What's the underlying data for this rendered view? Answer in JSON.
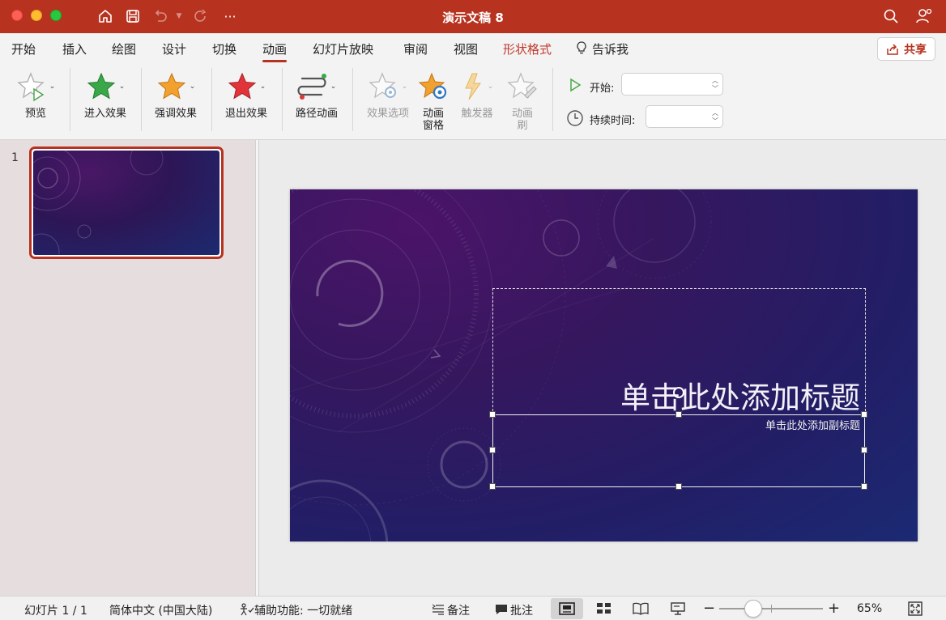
{
  "window": {
    "title": "演示文稿 8"
  },
  "tabs": [
    {
      "label": "开始"
    },
    {
      "label": "插入"
    },
    {
      "label": "绘图"
    },
    {
      "label": "设计"
    },
    {
      "label": "切换"
    },
    {
      "label": "动画",
      "active": true
    },
    {
      "label": "幻灯片放映"
    },
    {
      "label": "审阅"
    },
    {
      "label": "视图"
    },
    {
      "label": "形状格式",
      "accent": true
    },
    {
      "label": "告诉我",
      "icon": "lightbulb-icon"
    }
  ],
  "share": {
    "label": "共享"
  },
  "ribbon": {
    "preview": "预览",
    "entrance": "进入效果",
    "emphasis": "强调效果",
    "exit": "退出效果",
    "motion_path": "路径动画",
    "effect_options": "效果选项",
    "animation_pane_1": "动画",
    "animation_pane_2": "窗格",
    "trigger": "触发器",
    "painter_1": "动画",
    "painter_2": "刷",
    "start_label": "开始:",
    "duration_label": "持续时间:"
  },
  "panel": {
    "slide_number": "1"
  },
  "slide": {
    "title": "单击此处添加标题",
    "subtitle": "单击此处添加副标题"
  },
  "status": {
    "slide_counter": "幻灯片 1 / 1",
    "language": "简体中文 (中国大陆)",
    "accessibility": "辅助功能: 一切就绪",
    "notes": "备注",
    "comments": "批注",
    "zoom": "65%",
    "zoom_level": 0.65
  },
  "colors": {
    "titlebar": "#b7321f",
    "accent": "#c0392b",
    "star_green": "#3aa848",
    "star_orange": "#f2a02e",
    "star_red": "#e0343a"
  }
}
